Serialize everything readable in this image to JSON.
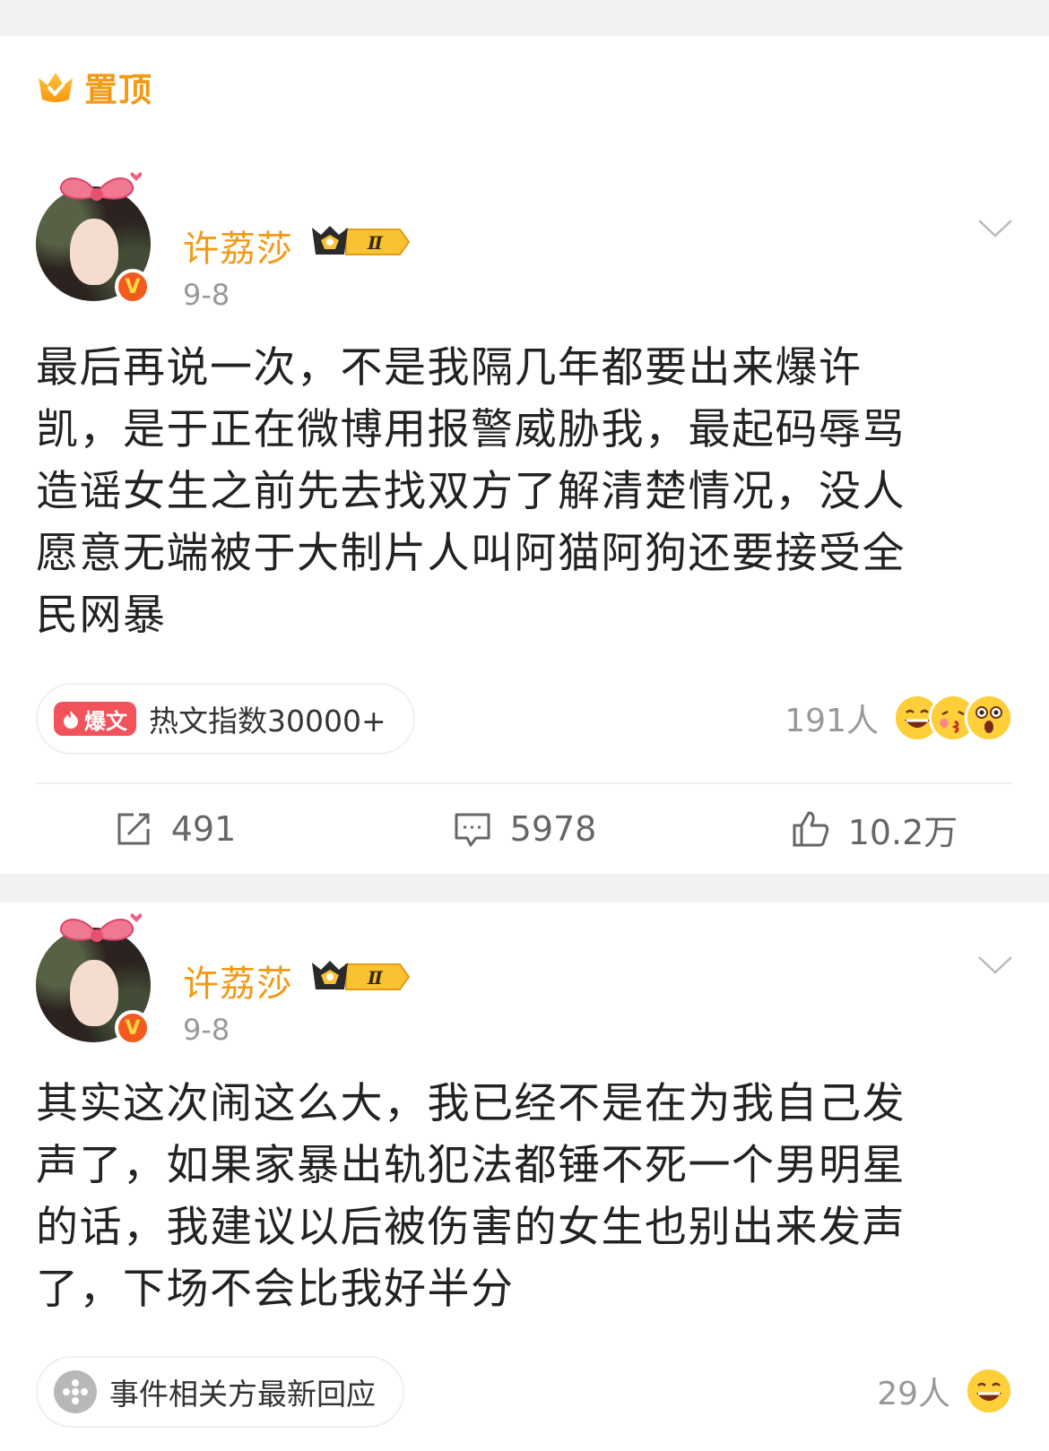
{
  "pinned": {
    "icon": "crown-pin-icon",
    "label": "置顶"
  },
  "posts": [
    {
      "username": "许荔莎",
      "vip_badge": "crown-vip-badge-icon",
      "vip_level": "Ⅱ",
      "date": "9-8",
      "text": "最后再说一次，不是我隔几年都要出来爆许凯，是于正在微博用报警威胁我，最起码辱骂造谣女生之前先去找双方了解清楚情况，没人愿意无端被于大制片人叫阿猫阿狗还要接受全民网暴",
      "topic": {
        "tag": "爆文",
        "label": "热文指数30000+"
      },
      "reactions": {
        "count": "191人",
        "emojis": [
          "grin-emoji-icon",
          "kiss-emoji-icon",
          "shocked-emoji-icon"
        ]
      },
      "actions": {
        "repost": "491",
        "comment": "5978",
        "like": "10.2万"
      }
    },
    {
      "username": "许荔莎",
      "vip_badge": "crown-vip-badge-icon",
      "vip_level": "Ⅱ",
      "date": "9-8",
      "text": "其实这次闹这么大，我已经不是在为我自己发声了，如果家暴出轨犯法都锤不死一个男明星的话，我建议以后被伤害的女生也别出来发声了，下场不会比我好半分",
      "topic": {
        "label": "事件相关方最新回应"
      },
      "reactions": {
        "count": "29人",
        "emojis": [
          "grin-emoji-icon"
        ]
      }
    }
  ],
  "colors": {
    "accent": "#f29a16",
    "hot_tag": "#f2525a",
    "verify": "#f25a1e",
    "text": "#222222",
    "muted": "#999999"
  }
}
